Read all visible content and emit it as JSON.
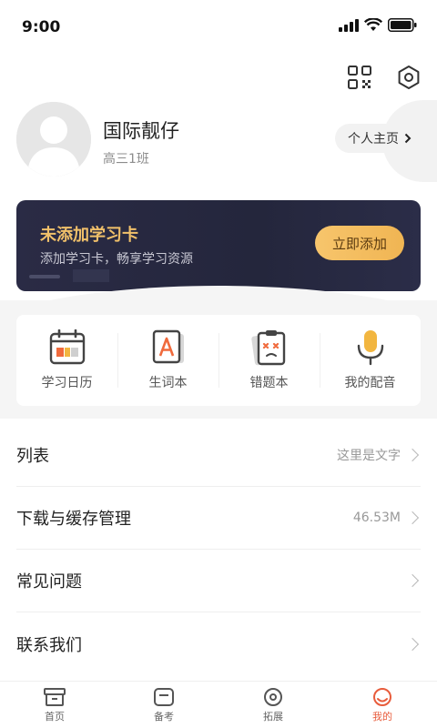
{
  "status": {
    "time": "9:00"
  },
  "profile": {
    "name": "国际靓仔",
    "class": "高三1班",
    "homepage_label": "个人主页"
  },
  "card": {
    "title": "未添加学习卡",
    "subtitle": "添加学习卡，畅享学习资源",
    "button": "立即添加"
  },
  "quick": [
    {
      "label": "学习日历",
      "icon": "calendar-icon"
    },
    {
      "label": "生词本",
      "icon": "word-book-icon"
    },
    {
      "label": "错题本",
      "icon": "mistake-book-icon"
    },
    {
      "label": "我的配音",
      "icon": "microphone-icon"
    }
  ],
  "menu": [
    {
      "label": "列表",
      "value": "这里是文字"
    },
    {
      "label": "下载与缓存管理",
      "value": "46.53M"
    },
    {
      "label": "常见问题",
      "value": ""
    },
    {
      "label": "联系我们",
      "value": ""
    }
  ],
  "tabs": [
    {
      "label": "首页",
      "icon": "home-icon"
    },
    {
      "label": "备考",
      "icon": "exam-icon"
    },
    {
      "label": "拓展",
      "icon": "extend-icon"
    },
    {
      "label": "我的",
      "icon": "profile-icon"
    }
  ],
  "colors": {
    "accent": "#f0b553",
    "card_bg": "#24263c",
    "active_tab": "#e85c3c"
  }
}
